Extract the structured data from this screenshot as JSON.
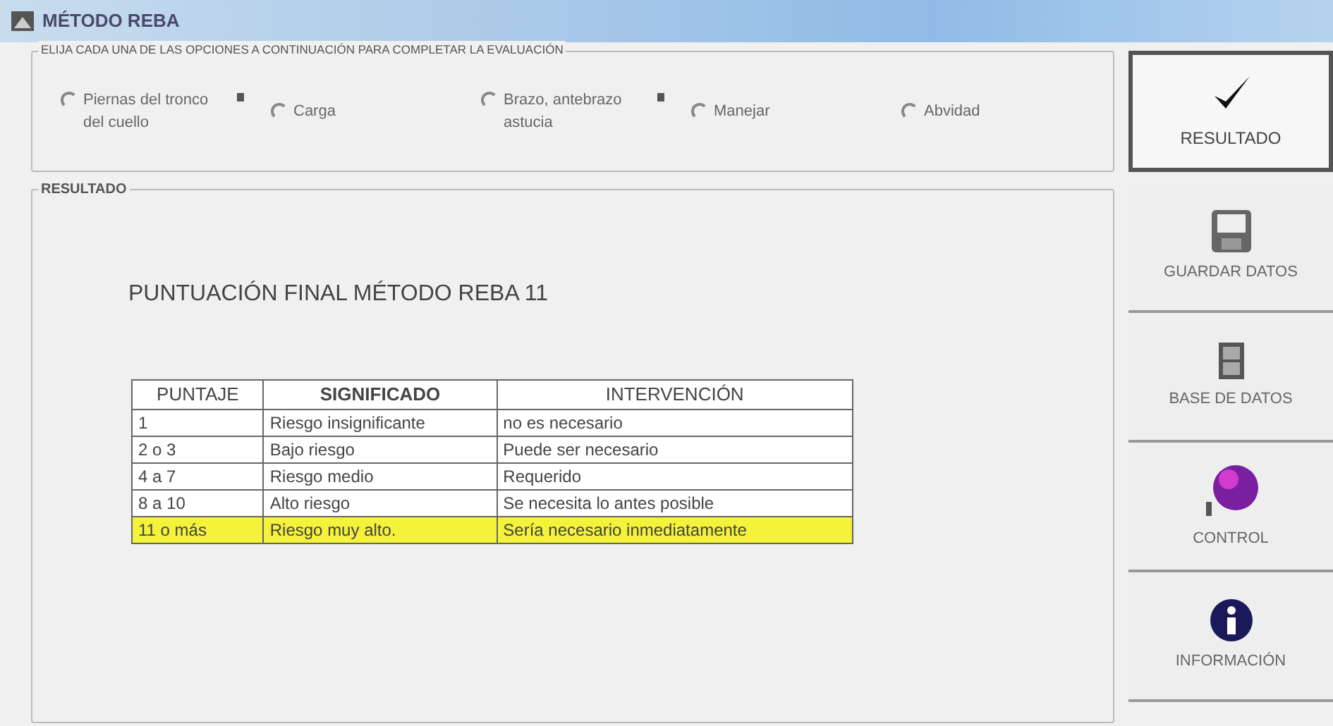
{
  "window": {
    "title": "MÉTODO REBA"
  },
  "options": {
    "legend": "ELIJA CADA UNA DE LAS OPCIONES A CONTINUACIÓN PARA COMPLETAR LA EVALUACIÓN",
    "items": [
      {
        "label": "Piernas del tronco del cuello",
        "selected": false,
        "marker": true
      },
      {
        "label": "Carga",
        "selected": false,
        "marker": false
      },
      {
        "label": "Brazo, antebrazo astucia",
        "selected": false,
        "marker": true
      },
      {
        "label": "Manejar",
        "selected": false,
        "marker": false
      },
      {
        "label": "Abvidad",
        "selected": false,
        "marker": false
      }
    ]
  },
  "result": {
    "legend": "RESULTADO",
    "heading": "PUNTUACIÓN FINAL MÉTODO REBA 11",
    "table": {
      "columns": [
        "PUNTAJE",
        "SIGNIFICADO",
        "INTERVENCIÓN"
      ],
      "rows": [
        {
          "cells": [
            "1",
            "Riesgo insignificante",
            "no es necesario"
          ],
          "highlighted": false
        },
        {
          "cells": [
            "2 o 3",
            "Bajo riesgo",
            "Puede ser necesario"
          ],
          "highlighted": false
        },
        {
          "cells": [
            "4 a 7",
            "Riesgo medio",
            "Requerido"
          ],
          "highlighted": false
        },
        {
          "cells": [
            "8 a 10",
            "Alto riesgo",
            "Se necesita lo antes posible"
          ],
          "highlighted": false
        },
        {
          "cells": [
            "11 o más",
            "Riesgo muy alto.",
            "Sería necesario inmediatamente"
          ],
          "highlighted": true
        }
      ]
    }
  },
  "buttons": [
    {
      "label": "RESULTADO",
      "kind": "check",
      "default": true
    },
    {
      "label": "GUARDAR DATOS",
      "kind": "floppy",
      "default": false
    },
    {
      "label": "BASE DE DATOS",
      "kind": "cabinet",
      "default": false
    },
    {
      "label": "CONTROL",
      "kind": "ball",
      "default": false
    },
    {
      "label": "INFORMACIÓN",
      "kind": "info",
      "default": false
    }
  ]
}
